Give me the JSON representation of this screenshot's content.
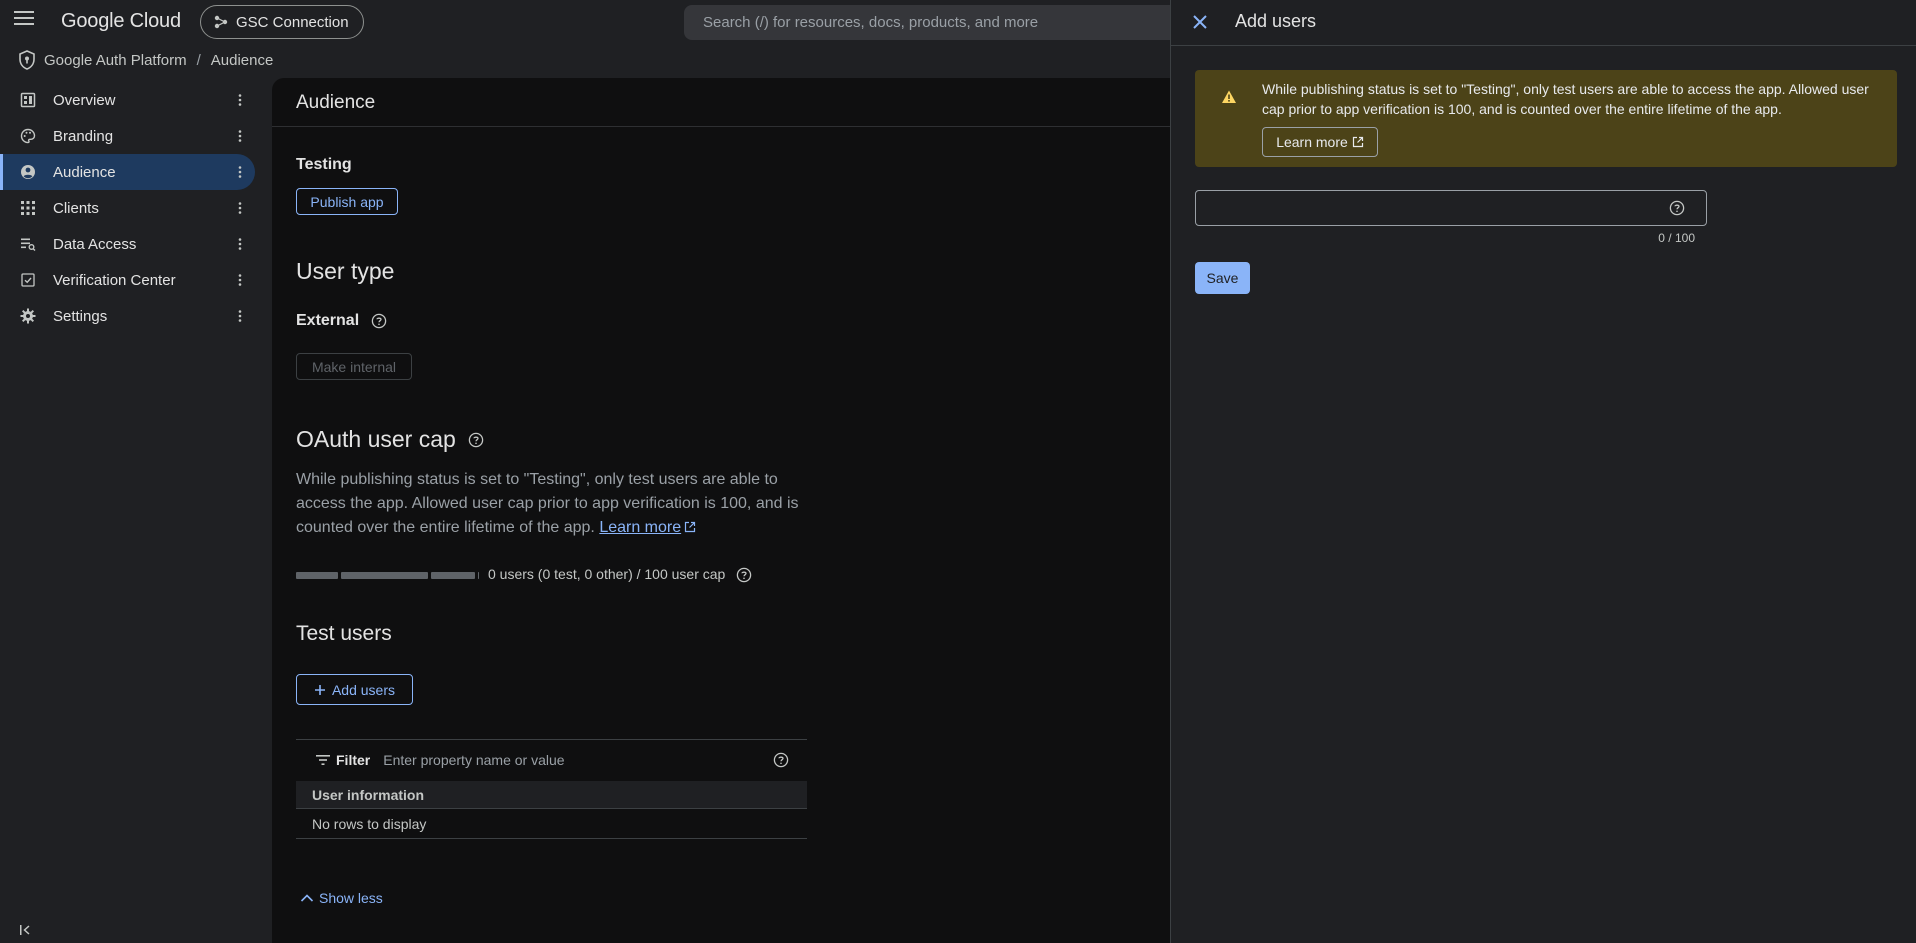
{
  "topbar": {
    "logo": "Google Cloud",
    "project": "GSC Connection",
    "search_placeholder": "Search (/) for resources, docs, products, and more"
  },
  "breadcrumb": {
    "root": "Google Auth Platform",
    "sep": "/",
    "current": "Audience"
  },
  "sidebar": {
    "items": [
      {
        "label": "Overview",
        "icon": "overview-icon",
        "active": false
      },
      {
        "label": "Branding",
        "icon": "palette-icon",
        "active": false
      },
      {
        "label": "Audience",
        "icon": "account-circle-icon",
        "active": true
      },
      {
        "label": "Clients",
        "icon": "apps-grid-icon",
        "active": false
      },
      {
        "label": "Data Access",
        "icon": "data-access-icon",
        "active": false
      },
      {
        "label": "Verification Center",
        "icon": "verified-checkbox-icon",
        "active": false
      },
      {
        "label": "Settings",
        "icon": "gear-icon",
        "active": false
      }
    ]
  },
  "main": {
    "title": "Audience",
    "publishing": {
      "status": "Testing",
      "publish_label": "Publish app"
    },
    "user_type": {
      "heading": "User type",
      "value": "External",
      "make_internal_label": "Make internal"
    },
    "oauth_cap": {
      "heading": "OAuth user cap",
      "description": "While publishing status is set to \"Testing\", only test users are able to access the app. Allowed user cap prior to app verification is 100, and is counted over the entire lifetime of the app.",
      "learn_more": "Learn more",
      "cap_text": "0 users (0 test, 0 other) / 100 user cap",
      "used_fraction": 0
    },
    "test_users": {
      "heading": "Test users",
      "add_label": "Add users",
      "filter_label": "Filter",
      "filter_placeholder": "Enter property name or value",
      "column_header": "User information",
      "empty_text": "No rows to display"
    },
    "show_less": "Show less"
  },
  "drawer": {
    "title": "Add users",
    "warning_text": "While publishing status is set to \"Testing\", only test users are able to access the app. Allowed user cap prior to app verification is 100, and is counted over the entire lifetime of the app.",
    "learn_more": "Learn more",
    "input_value": "",
    "counter": "0 / 100",
    "save_label": "Save"
  },
  "colors": {
    "accent": "#8ab4f8",
    "warning_bg": "#4c4318",
    "warning_icon": "#fdd663",
    "active_nav_bg": "#1e3a5f"
  }
}
